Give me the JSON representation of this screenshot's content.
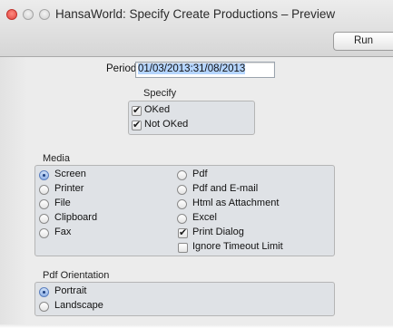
{
  "window": {
    "title": "HansaWorld: Specify Create Productions – Preview",
    "run_label": "Run"
  },
  "period": {
    "label": "Period",
    "value": "01/03/2013:31/08/2013"
  },
  "specify": {
    "label": "Specify",
    "options": [
      {
        "label": "OKed",
        "checked": true
      },
      {
        "label": "Not OKed",
        "checked": true
      }
    ]
  },
  "media": {
    "label": "Media",
    "left_options": [
      "Screen",
      "Printer",
      "File",
      "Clipboard",
      "Fax"
    ],
    "right_options": [
      "Pdf",
      "Pdf and E-mail",
      "Html as Attachment",
      "Excel"
    ],
    "selected": "Screen",
    "checkboxes": [
      {
        "label": "Print Dialog",
        "checked": true
      },
      {
        "label": "Ignore Timeout Limit",
        "checked": false
      }
    ]
  },
  "pdf_orientation": {
    "label": "Pdf Orientation",
    "options": [
      "Portrait",
      "Landscape"
    ],
    "selected": "Portrait"
  }
}
